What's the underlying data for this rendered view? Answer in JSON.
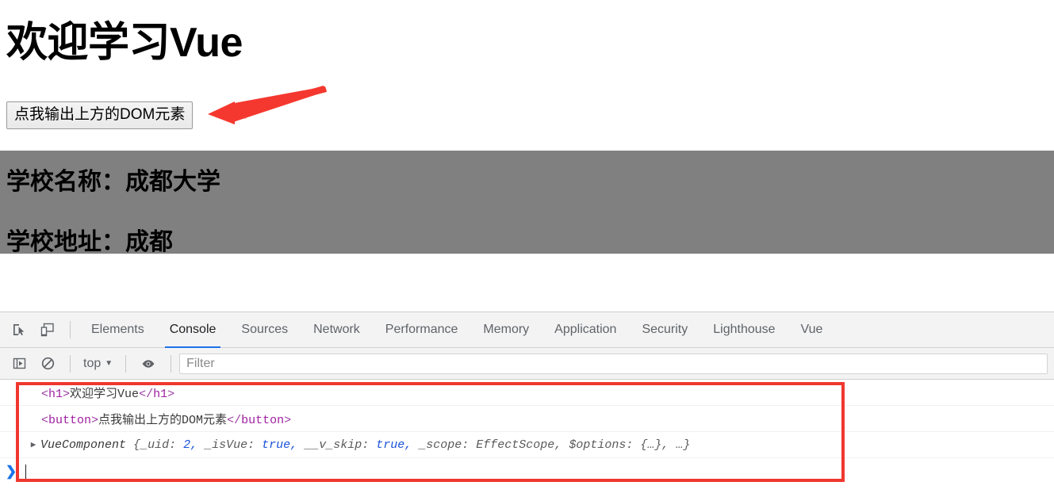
{
  "page": {
    "heading": "欢迎学习Vue",
    "button_label": "点我输出上方的DOM元素",
    "school_name_line": "学校名称：成都大学",
    "school_address_line": "学校地址：成都",
    "block_bg": "#808080",
    "annotation_arrow_color": "#f5382f"
  },
  "devtools": {
    "toolbar_icons": [
      {
        "name": "inspect-element-icon",
        "title": "Inspect element"
      },
      {
        "name": "device-toolbar-icon",
        "title": "Toggle device toolbar"
      }
    ],
    "tabs": [
      {
        "label": "Elements",
        "active": false
      },
      {
        "label": "Console",
        "active": true
      },
      {
        "label": "Sources",
        "active": false
      },
      {
        "label": "Network",
        "active": false
      },
      {
        "label": "Performance",
        "active": false
      },
      {
        "label": "Memory",
        "active": false
      },
      {
        "label": "Application",
        "active": false
      },
      {
        "label": "Security",
        "active": false
      },
      {
        "label": "Lighthouse",
        "active": false
      },
      {
        "label": "Vue",
        "active": false
      }
    ],
    "active_tab_indicator_color": "#1a73e8",
    "filterbar": {
      "sidebar_toggle_icon": "console-sidebar-icon",
      "clear_console_icon": "clear-console-icon",
      "context": "top",
      "context_caret": "▼",
      "eye_icon": "live-expression-eye-icon",
      "filter_placeholder": "Filter",
      "filter_value": ""
    },
    "console": {
      "rows": [
        {
          "type": "dom",
          "open_lt": "<",
          "open_tag": "h1",
          "open_gt": ">",
          "text": "欢迎学习Vue",
          "close_lt": "</",
          "close_tag": "h1",
          "close_gt": ">"
        },
        {
          "type": "dom",
          "open_lt": "<",
          "open_tag": "button",
          "open_gt": ">",
          "text": "点我输出上方的DOM元素",
          "close_lt": "</",
          "close_tag": "button",
          "close_gt": ">"
        }
      ],
      "object_row": {
        "disclosure": "▶",
        "constructor": "VueComponent",
        "brace_open": "{",
        "props": [
          {
            "key": "_uid:",
            "value": "2,",
            "kind": "number"
          },
          {
            "key": "_isVue:",
            "value": "true,",
            "kind": "boolean"
          },
          {
            "key": "__v_skip:",
            "value": "true,",
            "kind": "boolean"
          },
          {
            "key": "_scope:",
            "value": "EffectScope,",
            "kind": "object"
          },
          {
            "key": "$options:",
            "value": "{…},",
            "kind": "object"
          }
        ],
        "ellipsis": "…",
        "brace_close": "}"
      },
      "prompt": {
        "arrow": "❯",
        "value": ""
      },
      "annotation_box_color": "#f0372f"
    }
  }
}
